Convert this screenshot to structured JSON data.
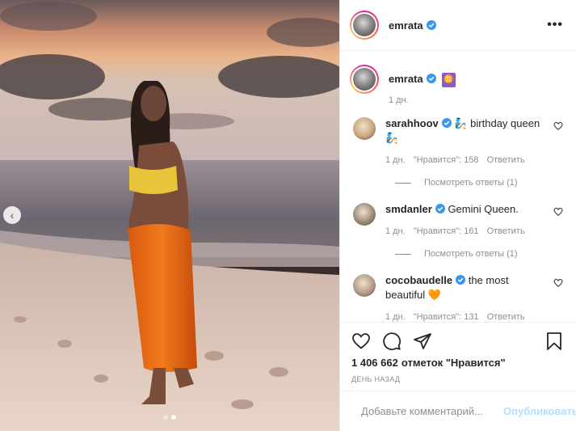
{
  "post": {
    "author": "emrata",
    "caption_emoji": "♊"
  },
  "photo": {
    "carousel_index": 2,
    "carousel_total": 2
  },
  "header": {
    "username": "emrata",
    "more_label": "•••"
  },
  "caption": {
    "username": "emrata",
    "emoji": "♊",
    "time": "1 дн."
  },
  "comments": [
    {
      "username": "sarahhoov",
      "text": "🧞 birthday queen 🧞",
      "time": "1 дн.",
      "likes": "\"Нравится\": 158",
      "reply": "Ответить",
      "view_replies": "Посмотреть ответы (1)"
    },
    {
      "username": "smdanler",
      "text": "Gemini Queen.",
      "time": "1 дн.",
      "likes": "\"Нравится\": 161",
      "reply": "Ответить",
      "view_replies": "Посмотреть ответы (1)"
    },
    {
      "username": "cocobaudelle",
      "text": "the most beautiful 🧡",
      "time": "1 дн.",
      "likes": "\"Нравится\": 131",
      "reply": "Ответить"
    }
  ],
  "actions": {
    "likes_count": "1 406 662",
    "likes_label": "отметок \"Нравится\"",
    "posted": "ДЕНЬ НАЗАД"
  },
  "add_comment": {
    "placeholder": "Добавьте комментарий...",
    "publish": "Опубликовать"
  },
  "icons": {
    "like": "heart-icon",
    "comment": "comment-icon",
    "share": "paper-plane-icon",
    "save": "bookmark-icon",
    "emoji": "smile-icon",
    "verified": "verified-badge-icon"
  },
  "colors": {
    "verified": "#3897f0",
    "publish_disabled": "#b2dffc",
    "secondary_text": "#8e8e8e"
  }
}
